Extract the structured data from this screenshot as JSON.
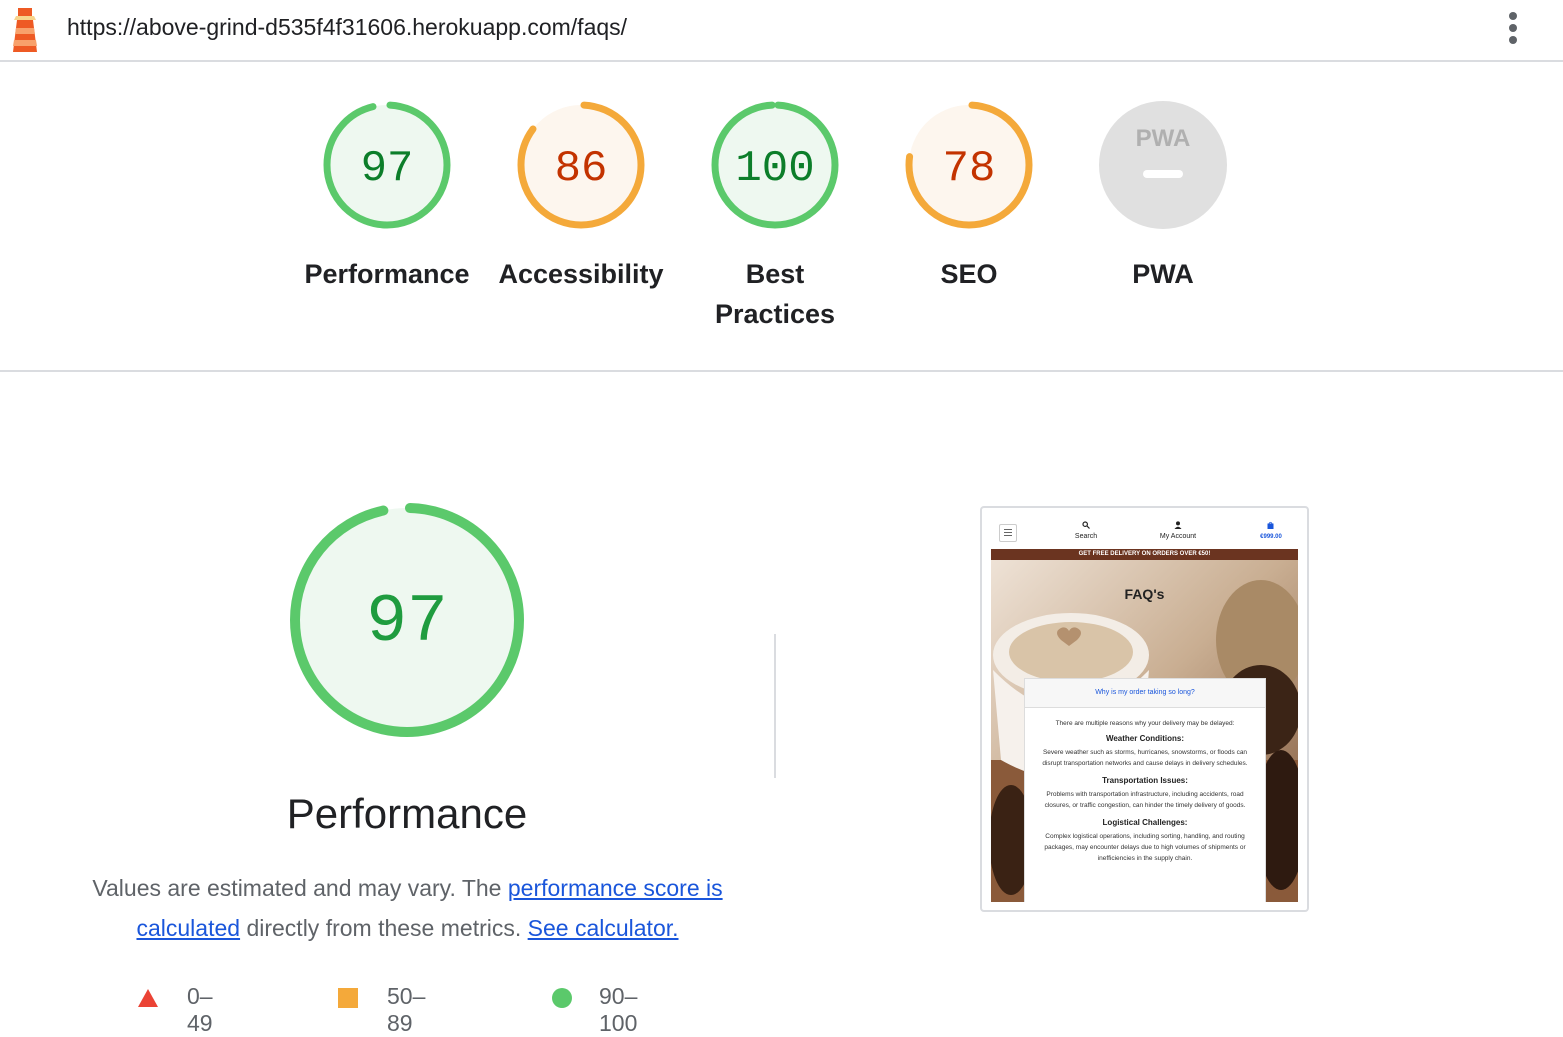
{
  "browser": {
    "url": "https://above-grind-d535f4f31606.herokuapp.com/faqs/",
    "menu_icon": "kebab-menu-icon",
    "logo_icon": "lighthouse-icon"
  },
  "categories": [
    {
      "label": "Performance",
      "score": "97",
      "rating": "pass"
    },
    {
      "label": "Accessibility",
      "score": "86",
      "rating": "average"
    },
    {
      "label": "Best Practices",
      "score": "100",
      "rating": "pass"
    },
    {
      "label": "SEO",
      "score": "78",
      "rating": "average"
    },
    {
      "label": "PWA",
      "score": "",
      "badge": "PWA",
      "rating": "na"
    }
  ],
  "performance": {
    "score": "97",
    "title": "Performance",
    "desc_start": "Values are estimated and may vary. The ",
    "link_score": "performance score is calculated",
    "desc_mid": " directly from these metrics. ",
    "link_calc": "See calculator."
  },
  "legend": [
    {
      "range": "0–49",
      "shape": "triangle",
      "color": "#eb4335"
    },
    {
      "range": "50–89",
      "shape": "square",
      "color": "#f4a93a"
    },
    {
      "range": "90–100",
      "shape": "circle",
      "color": "#5bc96b"
    }
  ],
  "screenshot": {
    "nav_search": "Search",
    "nav_account": "My Account",
    "nav_cart": "€999.00",
    "banner": "GET FREE DELIVERY ON ORDERS OVER €50!",
    "title": "FAQ's",
    "question": "Why is my order taking so long?",
    "intro": "There are multiple reasons why your delivery may be delayed:",
    "h1": "Weather Conditions:",
    "p1": "Severe weather such as storms, hurricanes, snowstorms, or floods can disrupt transportation networks and cause delays in delivery schedules.",
    "h2": "Transportation Issues:",
    "p2": "Problems with transportation infrastructure, including accidents, road closures, or traffic congestion, can hinder the timely delivery of goods.",
    "h3": "Logistical Challenges:",
    "p3": "Complex logistical operations, including sorting, handling, and routing packages, may encounter delays due to high volumes of shipments or inefficiencies in the supply chain."
  },
  "colors": {
    "pass": "#0c7e2a",
    "pass_arc": "#5bc96b",
    "pass_bg": "#eef8f0",
    "avg": "#c33300",
    "avg_arc": "#f4a93a",
    "avg_bg": "#fdf6ee",
    "na_bg": "#e0e0e0",
    "na_fg": "#b0b0b0"
  }
}
